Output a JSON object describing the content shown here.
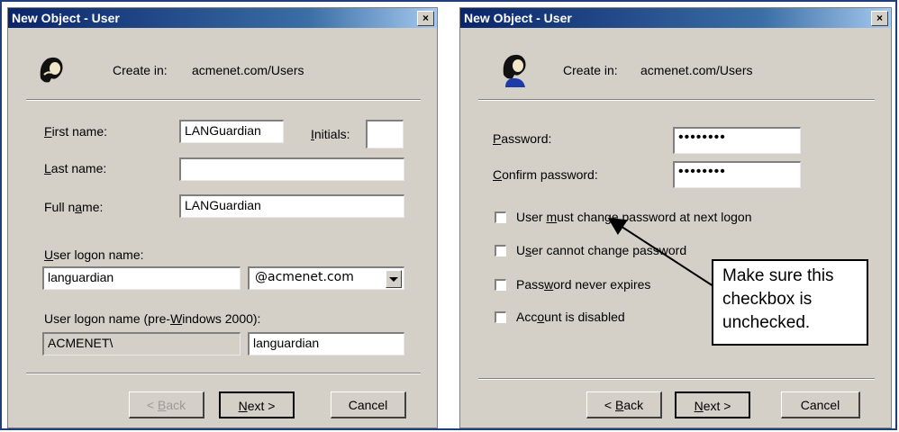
{
  "dialog1": {
    "title": "New Object - User",
    "close": "×",
    "create_in_label": "Create in:",
    "create_in_value": "acmenet.com/Users",
    "first_name_label": "First name:",
    "first_name_value": "LANGuardian",
    "initials_label": "Initials:",
    "initials_value": "",
    "last_name_label": "Last name:",
    "last_name_value": "",
    "full_name_label": "Full name:",
    "full_name_value": "LANGuardian",
    "logon_label": "User logon name:",
    "logon_value": "languardian",
    "domain_value": "@acmenet.com",
    "pre2000_label": "User logon name (pre-Windows 2000):",
    "pre2000_domain": "ACMENET\\",
    "pre2000_user": "languardian",
    "back": "< Back",
    "next": "Next >",
    "cancel": "Cancel"
  },
  "dialog2": {
    "title": "New Object - User",
    "close": "×",
    "create_in_label": "Create in:",
    "create_in_value": "acmenet.com/Users",
    "password_label": "Password:",
    "password_value": "••••••••",
    "confirm_label": "Confirm password:",
    "confirm_value": "••••••••",
    "checkboxes": [
      {
        "label": "User must change password at next logon",
        "checked": false
      },
      {
        "label": "User cannot change password",
        "checked": false
      },
      {
        "label": "Password never expires",
        "checked": false
      },
      {
        "label": "Account is disabled",
        "checked": false
      }
    ],
    "back": "< Back",
    "next": "Next >",
    "cancel": "Cancel"
  },
  "callout": {
    "text_line1": "Make sure this",
    "text_line2": "checkbox is",
    "text_line3": "unchecked."
  }
}
